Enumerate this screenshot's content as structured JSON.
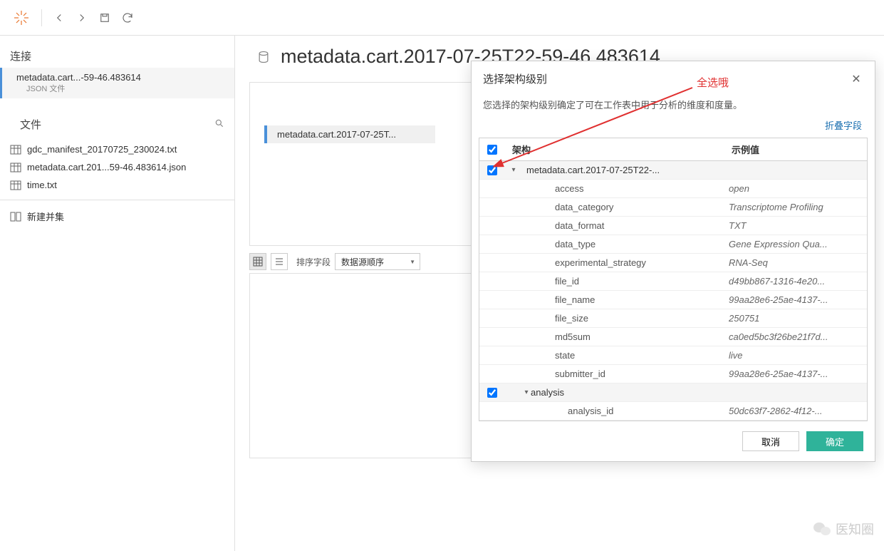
{
  "toolbar": {},
  "sidebar": {
    "conn_header": "连接",
    "conn_name": "metadata.cart...-59-46.483614",
    "conn_type": "JSON 文件",
    "files_header": "文件",
    "files": [
      "gdc_manifest_20170725_230024.txt",
      "metadata.cart.201...59-46.483614.json",
      "time.txt"
    ],
    "new_union": "新建并集"
  },
  "page": {
    "title": "metadata.cart.2017-07-25T22-59-46.483614",
    "pill": "metadata.cart.2017-07-25T..."
  },
  "grid": {
    "sort_label": "排序字段",
    "sort_value": "数据源顺序"
  },
  "dialog": {
    "title": "选择架构级别",
    "desc": "您选择的架构级别确定了可在工作表中用于分析的维度和度量。",
    "collapse": "折叠字段",
    "col1": "架构",
    "col2": "示例值",
    "root": "metadata.cart.2017-07-25T22-...",
    "fields": [
      {
        "k": "access",
        "v": "open"
      },
      {
        "k": "data_category",
        "v": "Transcriptome Profiling"
      },
      {
        "k": "data_format",
        "v": "TXT"
      },
      {
        "k": "data_type",
        "v": "Gene Expression Qua..."
      },
      {
        "k": "experimental_strategy",
        "v": "RNA-Seq"
      },
      {
        "k": "file_id",
        "v": "d49bb867-1316-4e20..."
      },
      {
        "k": "file_name",
        "v": "99aa28e6-25ae-4137-..."
      },
      {
        "k": "file_size",
        "v": "250751"
      },
      {
        "k": "md5sum",
        "v": "ca0ed5bc3f26be21f7d..."
      },
      {
        "k": "state",
        "v": "live"
      },
      {
        "k": "submitter_id",
        "v": "99aa28e6-25ae-4137-..."
      }
    ],
    "group2": "analysis",
    "g2_fields": [
      {
        "k": "analysis_id",
        "v": "50dc63f7-2862-4f12-..."
      }
    ],
    "cancel": "取消",
    "ok": "确定"
  },
  "annot": "全选哦",
  "watermark": "医知圈"
}
